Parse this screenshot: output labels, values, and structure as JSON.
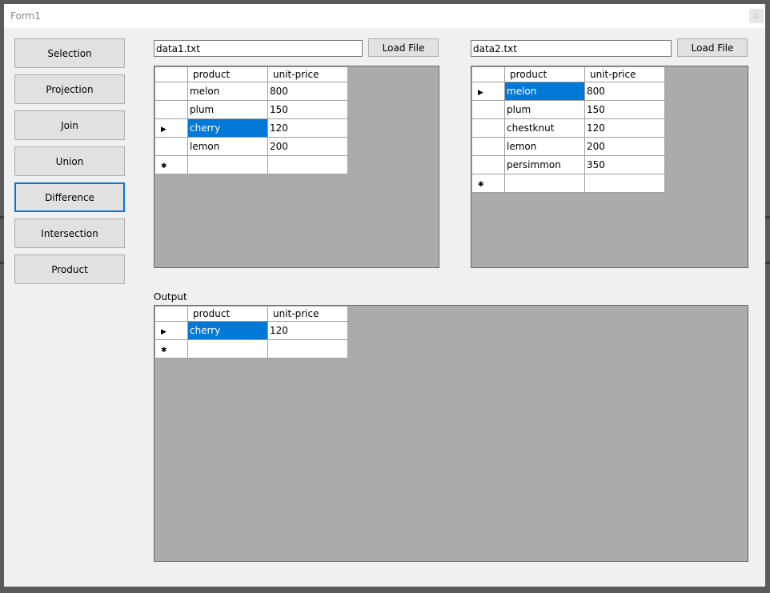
{
  "window": {
    "title": "Form1",
    "title_button": "⊥"
  },
  "operations": [
    {
      "label": "Selection",
      "active": false
    },
    {
      "label": "Projection",
      "active": false
    },
    {
      "label": "Join",
      "active": false
    },
    {
      "label": "Union",
      "active": false
    },
    {
      "label": "Difference",
      "active": true
    },
    {
      "label": "Intersection",
      "active": false
    },
    {
      "label": "Product",
      "active": false
    }
  ],
  "file1": {
    "value": "data1.txt",
    "load_label": "Load File"
  },
  "file2": {
    "value": "data2.txt",
    "load_label": "Load File"
  },
  "grid1": {
    "columns": [
      "product",
      "unit-price"
    ],
    "rows": [
      {
        "product": "melon",
        "price": "800"
      },
      {
        "product": "plum",
        "price": "150"
      },
      {
        "product": "cherry",
        "price": "120"
      },
      {
        "product": "lemon",
        "price": "200"
      }
    ]
  },
  "grid2": {
    "columns": [
      "product",
      "unit-price"
    ],
    "rows": [
      {
        "product": "melon",
        "price": "800"
      },
      {
        "product": "plum",
        "price": "150"
      },
      {
        "product": "chestknut",
        "price": "120"
      },
      {
        "product": "lemon",
        "price": "200"
      },
      {
        "product": "persimmon",
        "price": "350"
      }
    ]
  },
  "output": {
    "label": "Output",
    "columns": [
      "product",
      "unit-price"
    ],
    "rows": [
      {
        "product": "cherry",
        "price": "120"
      }
    ]
  },
  "markers": {
    "current": "▶",
    "new": "✱"
  }
}
